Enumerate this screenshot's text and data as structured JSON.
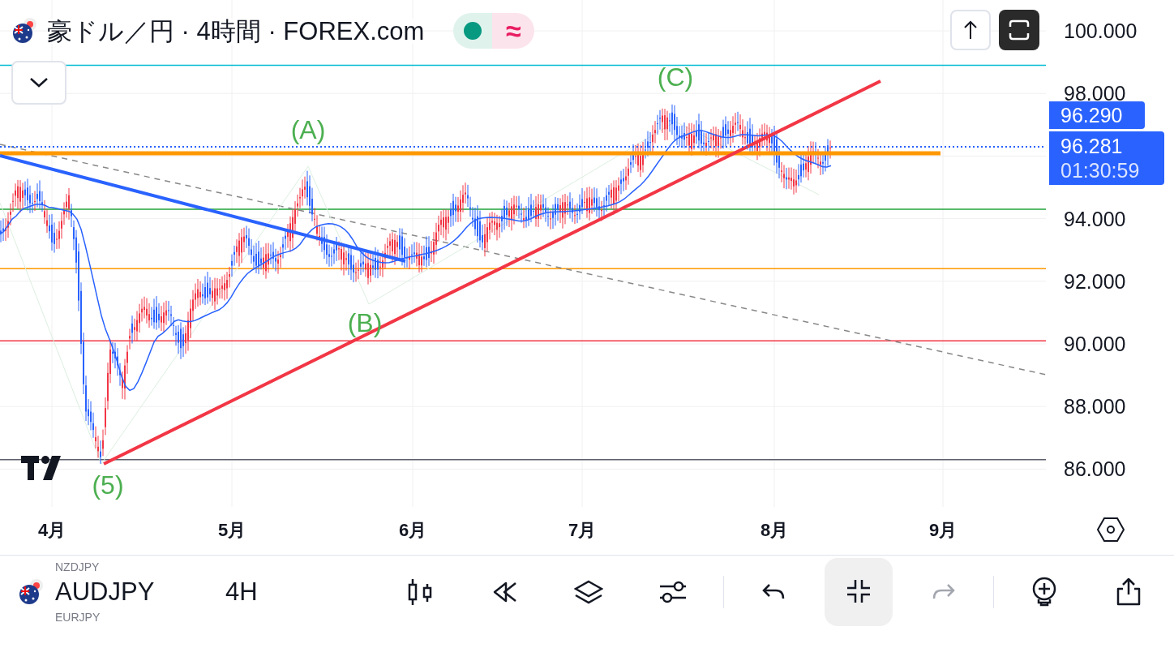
{
  "header": {
    "title": "豪ドル／円 · 4時間 · FOREX.com",
    "market_open": true,
    "wave_symbol": "≈"
  },
  "price_axis": [
    "100.000",
    "98.000",
    "94.000",
    "92.000",
    "90.000",
    "88.000",
    "86.000"
  ],
  "price_tags": [
    {
      "price": "96.290"
    },
    {
      "price": "96.281",
      "countdown": "01:30:59"
    }
  ],
  "wave_labels": [
    "(A)",
    "(B)",
    "(C)",
    "(5)"
  ],
  "time_axis": [
    "4月",
    "5月",
    "6月",
    "7月",
    "8月",
    "9月"
  ],
  "toolbar": {
    "symbol": "AUDJPY",
    "interval": "4H",
    "symbol_above": "NZDJPY",
    "symbol_below": "EURJPY",
    "buttons": [
      {
        "kind": "candles",
        "selected": false,
        "disabled": false
      },
      {
        "kind": "replay",
        "selected": false,
        "disabled": false
      },
      {
        "kind": "layers",
        "selected": false,
        "disabled": false
      },
      {
        "kind": "settings",
        "selected": false,
        "disabled": false
      },
      {
        "kind": "separator"
      },
      {
        "kind": "undo",
        "selected": false,
        "disabled": false
      },
      {
        "kind": "collapse",
        "selected": true,
        "disabled": false
      },
      {
        "kind": "redo",
        "selected": false,
        "disabled": true
      },
      {
        "kind": "separator"
      },
      {
        "kind": "alert",
        "selected": false,
        "disabled": false
      },
      {
        "kind": "share",
        "selected": false,
        "disabled": false
      }
    ]
  }
}
